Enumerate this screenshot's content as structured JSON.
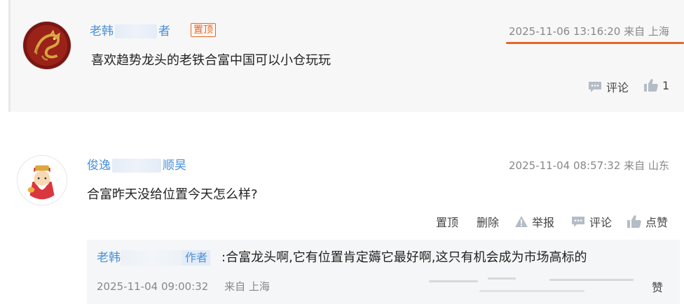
{
  "comments": [
    {
      "user_prefix": "老韩",
      "user_suffix": "者",
      "pin_badge": "置顶",
      "timestamp": "2025-11-06 13:16:20",
      "location": "来自 上海",
      "text": "喜欢趋势龙头的老铁合富中国可以小仓玩玩",
      "actions": {
        "comment": "评论",
        "like_count": "1"
      }
    },
    {
      "user_prefix": "俊逸",
      "user_suffix": "顺昊",
      "timestamp": "2025-11-04 08:57:32",
      "location": "来自 山东",
      "text": "合富昨天没给位置今天怎么样?",
      "actions": {
        "pin": "置顶",
        "delete": "删除",
        "report": "举报",
        "comment": "评论",
        "like": "点赞"
      }
    }
  ],
  "reply": {
    "user_prefix": "老韩",
    "author_tag": "作者",
    "text": ":合富龙头啊,它有位置肯定薅它最好啊,这只有机会成为市场高标的",
    "timestamp": "2025-11-04 09:00:32",
    "location": "来自 上海",
    "trailing_glyph": "赞"
  },
  "colors": {
    "link": "#4a90d9",
    "accent": "#e4672a",
    "muted": "#888888",
    "icon": "#b4bcc6"
  },
  "icons": [
    "comment-icon",
    "thumbs-up-icon",
    "warning-icon",
    "dragon-avatar",
    "fortune-god-avatar"
  ]
}
